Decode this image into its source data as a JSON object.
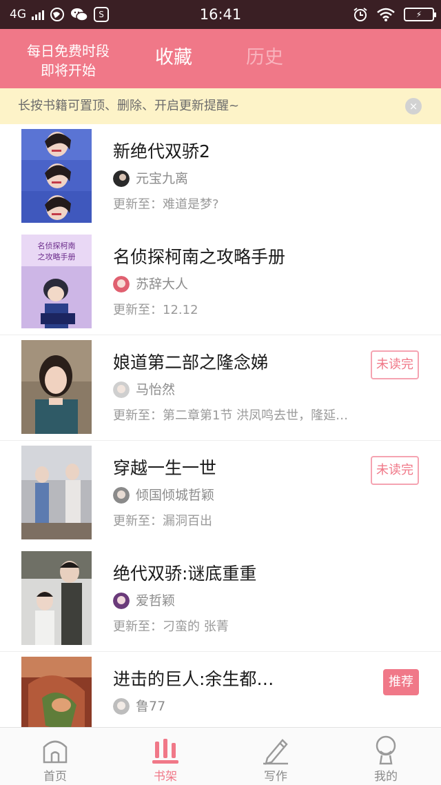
{
  "status_bar": {
    "network": "4G",
    "time": "16:41",
    "icons": [
      "signal-icon",
      "browser-icon",
      "wechat-icon",
      "s-icon",
      "alarm-icon",
      "wifi-icon",
      "battery-icon"
    ]
  },
  "header": {
    "free_slot_line1": "每日免费时段",
    "free_slot_line2": "即将开始",
    "tabs": [
      {
        "label": "收藏",
        "active": true
      },
      {
        "label": "历史",
        "active": false
      }
    ],
    "color": "#f07888"
  },
  "tip": {
    "text": "长按书籍可置顶、删除、开启更新提醒~",
    "close": "×"
  },
  "books": [
    {
      "title": "新绝代双骄2",
      "author": "元宝九离",
      "update": "更新至：难道是梦?",
      "badge": ""
    },
    {
      "title": "名侦探柯南之攻略手册",
      "author": "苏辞大人",
      "update": "更新至：12.12",
      "badge": "",
      "cover_text": "名侦探柯南之攻略手册"
    },
    {
      "title": "娘道第二部之隆念娣",
      "author": "马怡然",
      "update": "更新至：第二章第1节 洪凤鸣去世，隆延…",
      "badge": "未读完"
    },
    {
      "title": "穿越一生一世",
      "author": "倾国倾城哲颖",
      "update": "更新至：漏洞百出",
      "badge": "未读完"
    },
    {
      "title": "绝代双骄:谜底重重",
      "author": "爱哲颖",
      "update": "更新至：刁蛮的 张菁",
      "badge": ""
    },
    {
      "title": "进击的巨人:余生都…",
      "author": "鲁77",
      "update": "",
      "badge": "推荐"
    }
  ],
  "nav": [
    {
      "label": "首页",
      "icon": "home-icon",
      "active": false
    },
    {
      "label": "书架",
      "icon": "bookshelf-icon",
      "active": true
    },
    {
      "label": "写作",
      "icon": "pen-icon",
      "active": false
    },
    {
      "label": "我的",
      "icon": "profile-icon",
      "active": false
    }
  ],
  "colors": {
    "accent": "#f07888",
    "tip_bg": "#fdf3c8",
    "statusbar_bg": "#3a1f24"
  }
}
